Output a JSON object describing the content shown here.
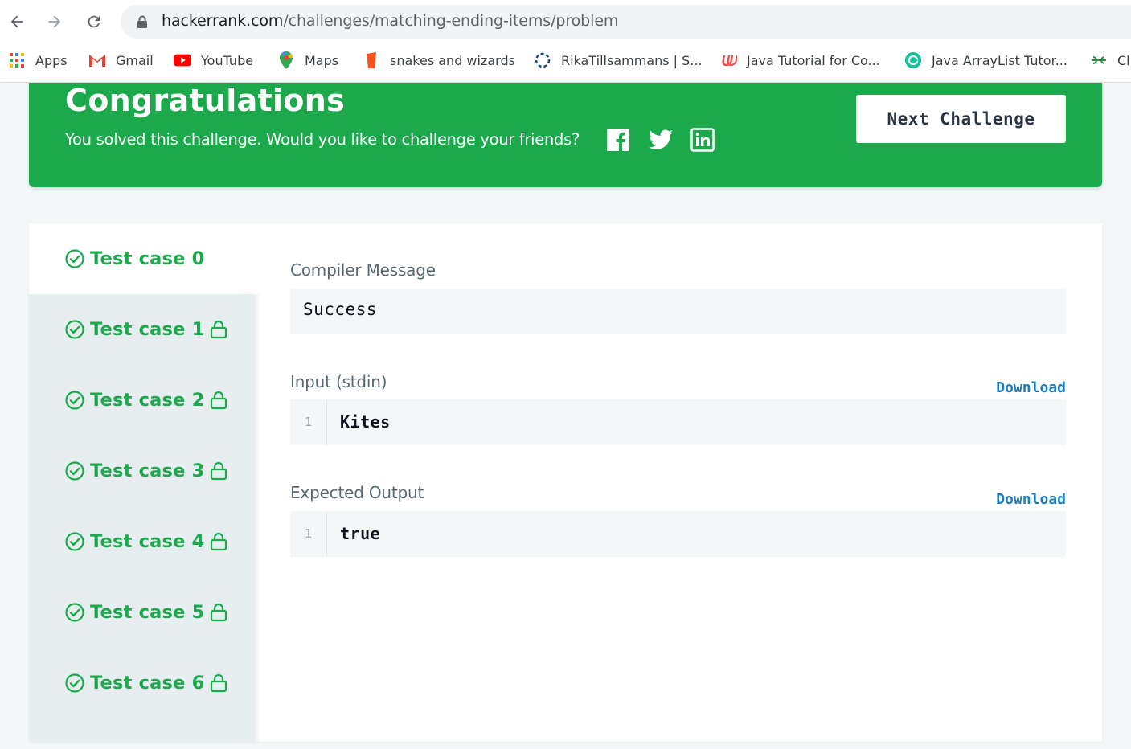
{
  "browser": {
    "url_host": "hackerrank.com",
    "url_path": "/challenges/matching-ending-items/problem",
    "bookmarks": [
      {
        "label": "Apps",
        "icon": "apps-grid-icon"
      },
      {
        "label": "Gmail",
        "icon": "gmail-icon"
      },
      {
        "label": "YouTube",
        "icon": "youtube-icon"
      },
      {
        "label": "Maps",
        "icon": "maps-pin-icon"
      },
      {
        "label": "snakes and wizards",
        "icon": "snakes-icon"
      },
      {
        "label": "RikaTillsammans | S...",
        "icon": "rika-icon"
      },
      {
        "label": "Java Tutorial for Co...",
        "icon": "udemy-icon"
      },
      {
        "label": "Java ArrayList Tutor...",
        "icon": "grammarly-icon"
      },
      {
        "label": "Cl",
        "icon": "geeks-icon"
      }
    ]
  },
  "banner": {
    "title": "Congratulations",
    "subtitle": "You solved this challenge. Would you like to challenge your friends?",
    "next_label": "Next Challenge",
    "color": "#1ba94c"
  },
  "tabs": [
    {
      "label": "Test case 0",
      "locked": false,
      "active": true
    },
    {
      "label": "Test case 1",
      "locked": true,
      "active": false
    },
    {
      "label": "Test case 2",
      "locked": true,
      "active": false
    },
    {
      "label": "Test case 3",
      "locked": true,
      "active": false
    },
    {
      "label": "Test case 4",
      "locked": true,
      "active": false
    },
    {
      "label": "Test case 5",
      "locked": true,
      "active": false
    },
    {
      "label": "Test case 6",
      "locked": true,
      "active": false
    }
  ],
  "result": {
    "compiler_label": "Compiler Message",
    "compiler_message": "Success",
    "input_label": "Input (stdin)",
    "input_download": "Download",
    "input_line_no": "1",
    "input_value": "Kites",
    "output_label": "Expected Output",
    "output_download": "Download",
    "output_line_no": "1",
    "output_value": "true"
  }
}
